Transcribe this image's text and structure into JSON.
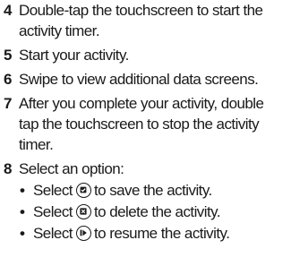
{
  "steps": [
    {
      "number": "4",
      "lines": [
        "Double-tap the touchscreen to start the",
        "activity timer."
      ]
    },
    {
      "number": "5",
      "lines": [
        "Start your activity."
      ]
    },
    {
      "number": "6",
      "lines": [
        "Swipe to view additional data screens."
      ]
    },
    {
      "number": "7",
      "lines": [
        "After you complete your activity, double",
        "tap the touchscreen to stop the activity",
        "timer."
      ]
    },
    {
      "number": "8",
      "lines": [
        "Select an option:"
      ]
    }
  ],
  "options": [
    {
      "bullet": "•",
      "prefix": "Select",
      "icon": "save-icon",
      "suffix": "to save the activity."
    },
    {
      "bullet": "•",
      "prefix": "Select",
      "icon": "delete-icon",
      "suffix": "to delete the activity."
    },
    {
      "bullet": "•",
      "prefix": "Select",
      "icon": "resume-icon",
      "suffix": "to resume the activity."
    }
  ]
}
